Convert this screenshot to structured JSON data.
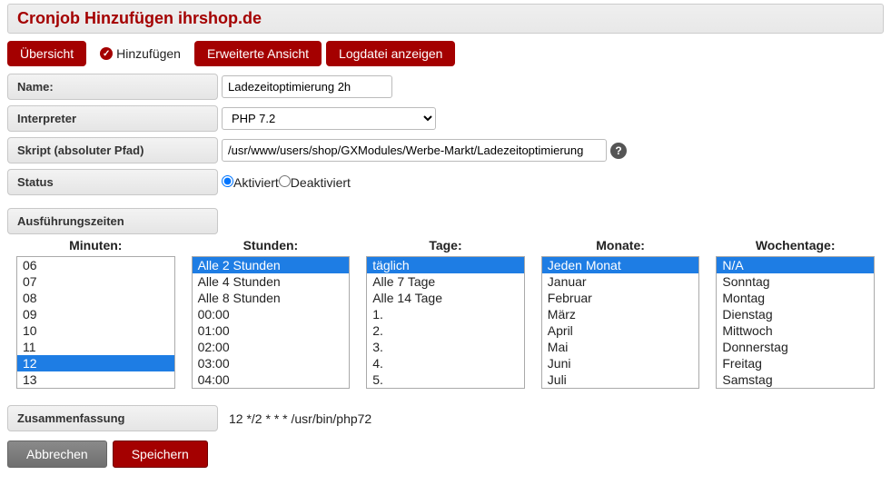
{
  "title": "Cronjob Hinzufügen ihrshop.de",
  "tabs": {
    "overview": "Übersicht",
    "add": "Hinzufügen",
    "extended": "Erweiterte Ansicht",
    "log": "Logdatei anzeigen"
  },
  "form": {
    "name_label": "Name:",
    "name_value": "Ladezeitoptimierung 2h",
    "interpreter_label": "Interpreter",
    "interpreter_value": "PHP 7.2",
    "script_label": "Skript (absoluter Pfad)",
    "script_value": "/usr/www/users/shop/GXModules/Werbe-Markt/Ladezeitoptimierung",
    "status_label": "Status",
    "status_activated": "Aktiviert",
    "status_deactivated": "Deaktiviert"
  },
  "times": {
    "heading": "Ausführungszeiten",
    "minutes": {
      "label": "Minuten:",
      "items": [
        "06",
        "07",
        "08",
        "09",
        "10",
        "11",
        "12",
        "13"
      ],
      "selected": "12"
    },
    "hours": {
      "label": "Stunden:",
      "items": [
        "Alle 2 Stunden",
        "Alle 4 Stunden",
        "Alle 8 Stunden",
        "00:00",
        "01:00",
        "02:00",
        "03:00",
        "04:00"
      ],
      "selected": "Alle 2 Stunden"
    },
    "days": {
      "label": "Tage:",
      "items": [
        "täglich",
        "Alle 7 Tage",
        "Alle 14 Tage",
        "1.",
        "2.",
        "3.",
        "4.",
        "5."
      ],
      "selected": "täglich"
    },
    "months": {
      "label": "Monate:",
      "items": [
        "Jeden Monat",
        "Januar",
        "Februar",
        "März",
        "April",
        "Mai",
        "Juni",
        "Juli"
      ],
      "selected": "Jeden Monat"
    },
    "weekdays": {
      "label": "Wochentage:",
      "items": [
        "N/A",
        "Sonntag",
        "Montag",
        "Dienstag",
        "Mittwoch",
        "Donnerstag",
        "Freitag",
        "Samstag"
      ],
      "selected": "N/A"
    }
  },
  "summary": {
    "label": "Zusammenfassung",
    "text": "12  */2  *  *  *  /usr/bin/php72"
  },
  "footer": {
    "cancel": "Abbrechen",
    "save": "Speichern"
  }
}
